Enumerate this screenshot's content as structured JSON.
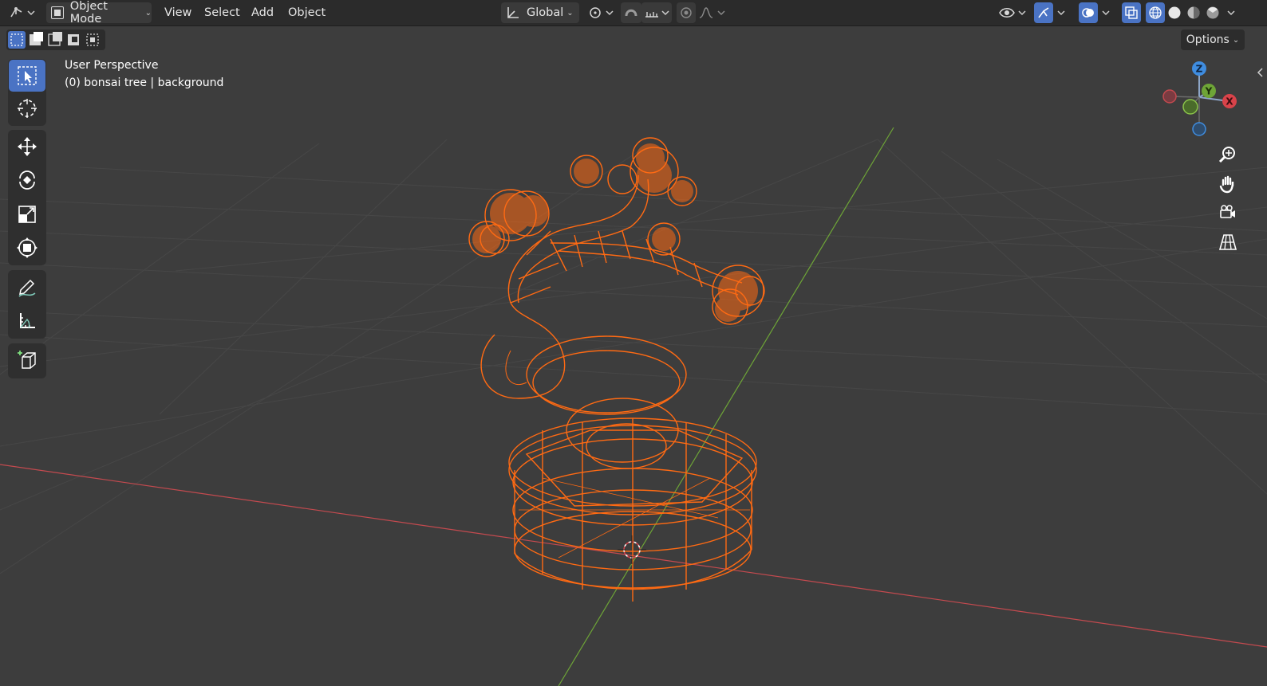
{
  "header": {
    "editor_type_icon": "3d-viewport-icon",
    "mode": "Object Mode",
    "menus": [
      "View",
      "Select",
      "Add",
      "Object"
    ],
    "transform_orientation": "Global",
    "pivot_icon": "pivot-point-icon",
    "snap_icon": "snap-icon",
    "proportional_icon": "proportional-edit-icon",
    "visibility_icon": "visibility-icon",
    "gizmo_icon": "gizmo-icon",
    "overlay_icon": "overlay-icon",
    "xray_icon": "xray-icon",
    "shading_modes": [
      "wireframe",
      "solid",
      "material",
      "rendered"
    ]
  },
  "viewport": {
    "view_name": "User Perspective",
    "object_info": "(0) bonsai tree | background",
    "options_label": "Options",
    "selection_modes": [
      "set",
      "extend",
      "subtract",
      "difference",
      "intersect"
    ],
    "tools": [
      "select-box",
      "cursor",
      "move",
      "rotate",
      "scale",
      "transform",
      "annotate",
      "measure",
      "add-cube"
    ],
    "nav_gizmo": {
      "z": "Z",
      "y": "Y",
      "x": "X"
    },
    "nav_buttons": [
      "zoom",
      "pan",
      "camera",
      "ortho-toggle"
    ],
    "colors": {
      "selection": "#ff6a13",
      "axis_x": "#d9434a",
      "axis_y": "#6ea537",
      "axis_z": "#3f8de0",
      "accent": "#4a73c4"
    }
  }
}
